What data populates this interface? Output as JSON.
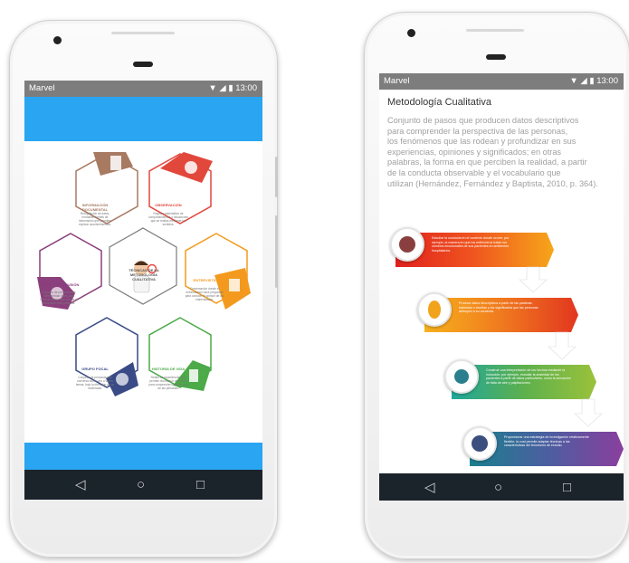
{
  "phone1": {
    "status": {
      "carrier": "Marvel",
      "time": "13:00",
      "icons": "▼ ◢ ▮"
    },
    "center": {
      "title": "TÉCNICAS DE LA METODOLOGÍA CUALITATIVA"
    },
    "hexes": [
      {
        "title": "INFORMACIÓN DOCUMENTAL",
        "desc": "Recopilación de datos, mediante fuentes de información que permiten explicar acontecimientos.",
        "color": "#a87a62"
      },
      {
        "title": "OBSERVACIÓN",
        "desc": "Registro sistemático de comportamientos o situaciones que se realiza mediante los sentidos.",
        "color": "#e2473c"
      },
      {
        "title": "GRUPO DE DISCUSIÓN",
        "desc": "Conjunto de personas que intercambian ideas para resolver consensos, donde el moderador está presente.",
        "color": "#8b3f7c"
      },
      {
        "title": "ENTREVISTA",
        "desc": "Conversación donde el entrevistador hace preguntas para conocer la opinión de los entrevistados.",
        "color": "#f39a1e"
      },
      {
        "title": "GRUPO FOCAL",
        "desc": "Conjunto de personas que conversa sobre uno o varios temas, bajo la dirección de un moderador.",
        "color": "#3a4a86"
      },
      {
        "title": "HISTORIA DE VIDA",
        "desc": "Relato de experiencias que permite reconstruir un evento para comprender mejor la vida de las personas.",
        "color": "#4caa48"
      }
    ],
    "nav": {
      "back": "◁",
      "home": "○",
      "recent": "□"
    }
  },
  "phone2": {
    "status": {
      "carrier": "Marvel",
      "time": "13:00",
      "icons": "▼ ◢ ▮"
    },
    "title": "Metodología Cualitativa",
    "paragraph": "Conjunto de pasos que producen datos descriptivos\n para comprender la perspectiva de las personas,\nlos fenómenos que las rodean y profundizar en sus\nexperiencias, opiniones y significados; en otras\npalabras, la forma en que perciben la realidad, a partir\n de la conducta observable y el vocabulario que\n utilizan (Hernández, Fernández y Baptista, 2010, p. 364).",
    "steps": [
      {
        "text": "Estudiar la conducta en el contexto donde ocurre; por ejemplo, la manera en que los enfermeros tratan los cambios emocionales de sus pacientes en ambientes hospitalarios."
      },
      {
        "text": "Produce datos descriptivos a partir de las palabras habladas o escritas y los significados que las personas atribuyen a su conducta."
      },
      {
        "text": "Construir una interpretación de los hechos mediante la inducción; por ejemplo, estudiar la ansiedad de los pacientes a partir de datos particulares, como la sensación de falta de aire y palpitaciones."
      },
      {
        "text": "Proporcionar una estrategia de investigación relativamente flexible, la cual permite adaptar técnicas a las características del fenómeno de estudio."
      }
    ],
    "nav": {
      "back": "◁",
      "home": "○",
      "recent": "□"
    }
  }
}
